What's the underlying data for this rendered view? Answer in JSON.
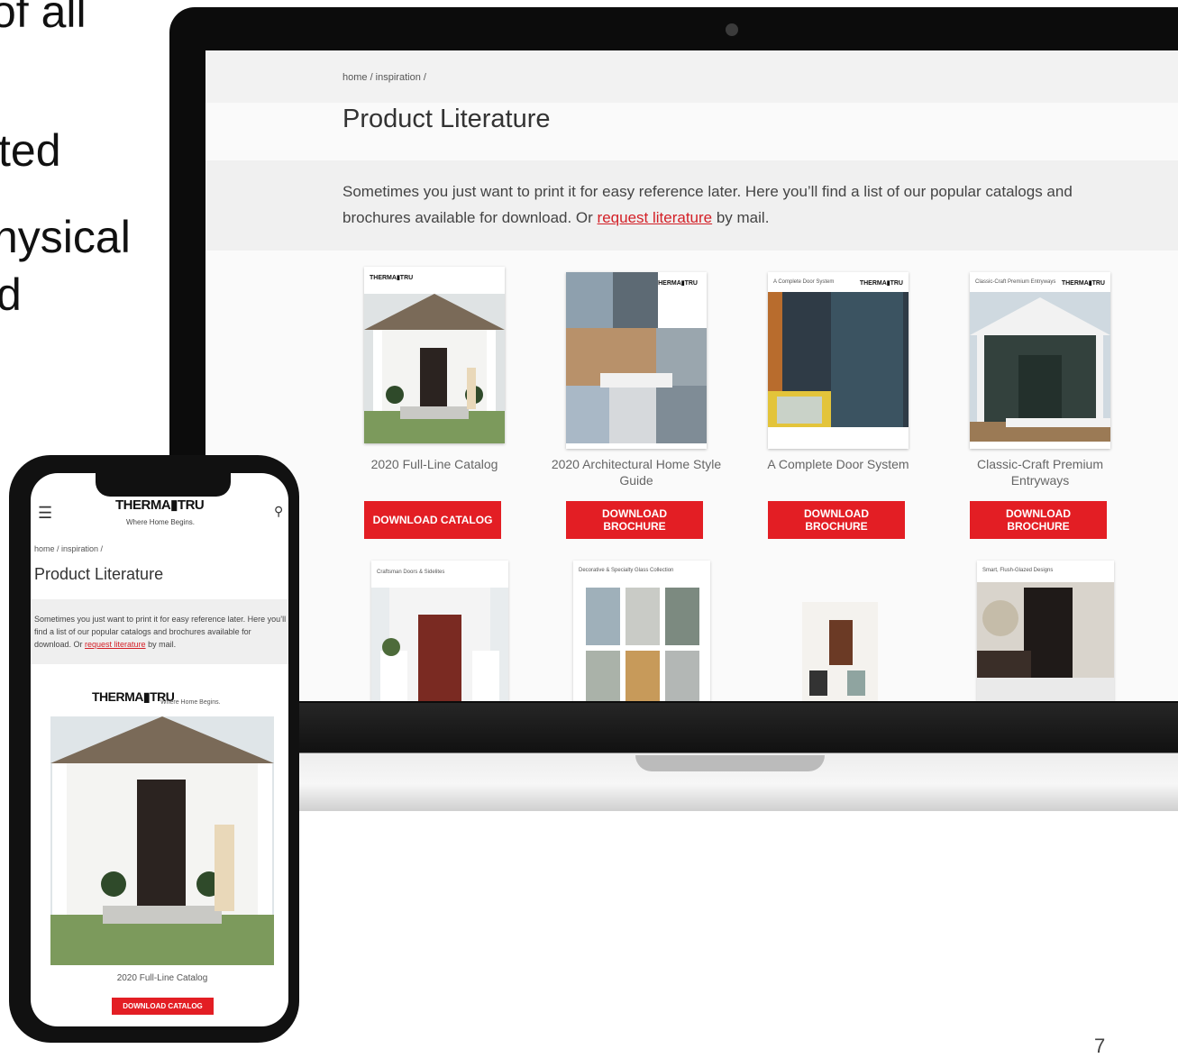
{
  "slide": {
    "text_fragments": [
      "of all",
      "ted",
      "nysical",
      "d"
    ],
    "page_number": "7"
  },
  "laptop": {
    "breadcrumb": "home / inspiration /",
    "title": "Product Literature",
    "intro_before": "Sometimes you just want to print it for easy reference later. Here you’ll find a list of our popular catalogs and brochures available for download. Or ",
    "intro_link": "request literature",
    "intro_after": " by mail.",
    "cards": [
      {
        "header": "",
        "logo": "THERMA▮TRU",
        "title": "2020 Full-Line Catalog",
        "button": "DOWNLOAD CATALOG"
      },
      {
        "header": "",
        "logo": "THERMA▮TRU",
        "title": "2020 Architectural Home Style Guide",
        "button": "DOWNLOAD BROCHURE"
      },
      {
        "header": "A Complete Door System",
        "logo": "THERMA▮TRU",
        "title": "A Complete Door System",
        "button": "DOWNLOAD BROCHURE"
      },
      {
        "header": "Classic-Craft Premium Entryways",
        "logo": "THERMA▮TRU",
        "title": "Classic-Craft Premium Entryways",
        "button": "DOWNLOAD BROCHURE"
      }
    ],
    "row2": [
      {
        "header": "Craftsman Doors & Sidelites"
      },
      {
        "header": "Decorative & Specialty Glass Collection"
      },
      {
        "header": ""
      },
      {
        "header": "Smart, Flush-Glazed Designs"
      }
    ]
  },
  "phone": {
    "logo": "THERMA▮TRU",
    "tagline": "Where Home Begins.",
    "breadcrumb": "home / inspiration /",
    "title": "Product Literature",
    "intro_before": "Sometimes you just want to print it for easy reference later. Here you’ll find a list of our popular catalogs and brochures available for download. Or ",
    "intro_link": "request literature",
    "intro_after": " by mail.",
    "cover_logo": "THERMA▮TRU",
    "cover_tag": "Where Home Begins.",
    "caption": "2020 Full-Line Catalog",
    "button": "DOWNLOAD CATALOG"
  },
  "colors": {
    "accent": "#e31e24",
    "link": "#d32027"
  },
  "icons": {
    "menu": "hamburger-icon",
    "search": "search-icon",
    "camera": "camera-icon"
  }
}
